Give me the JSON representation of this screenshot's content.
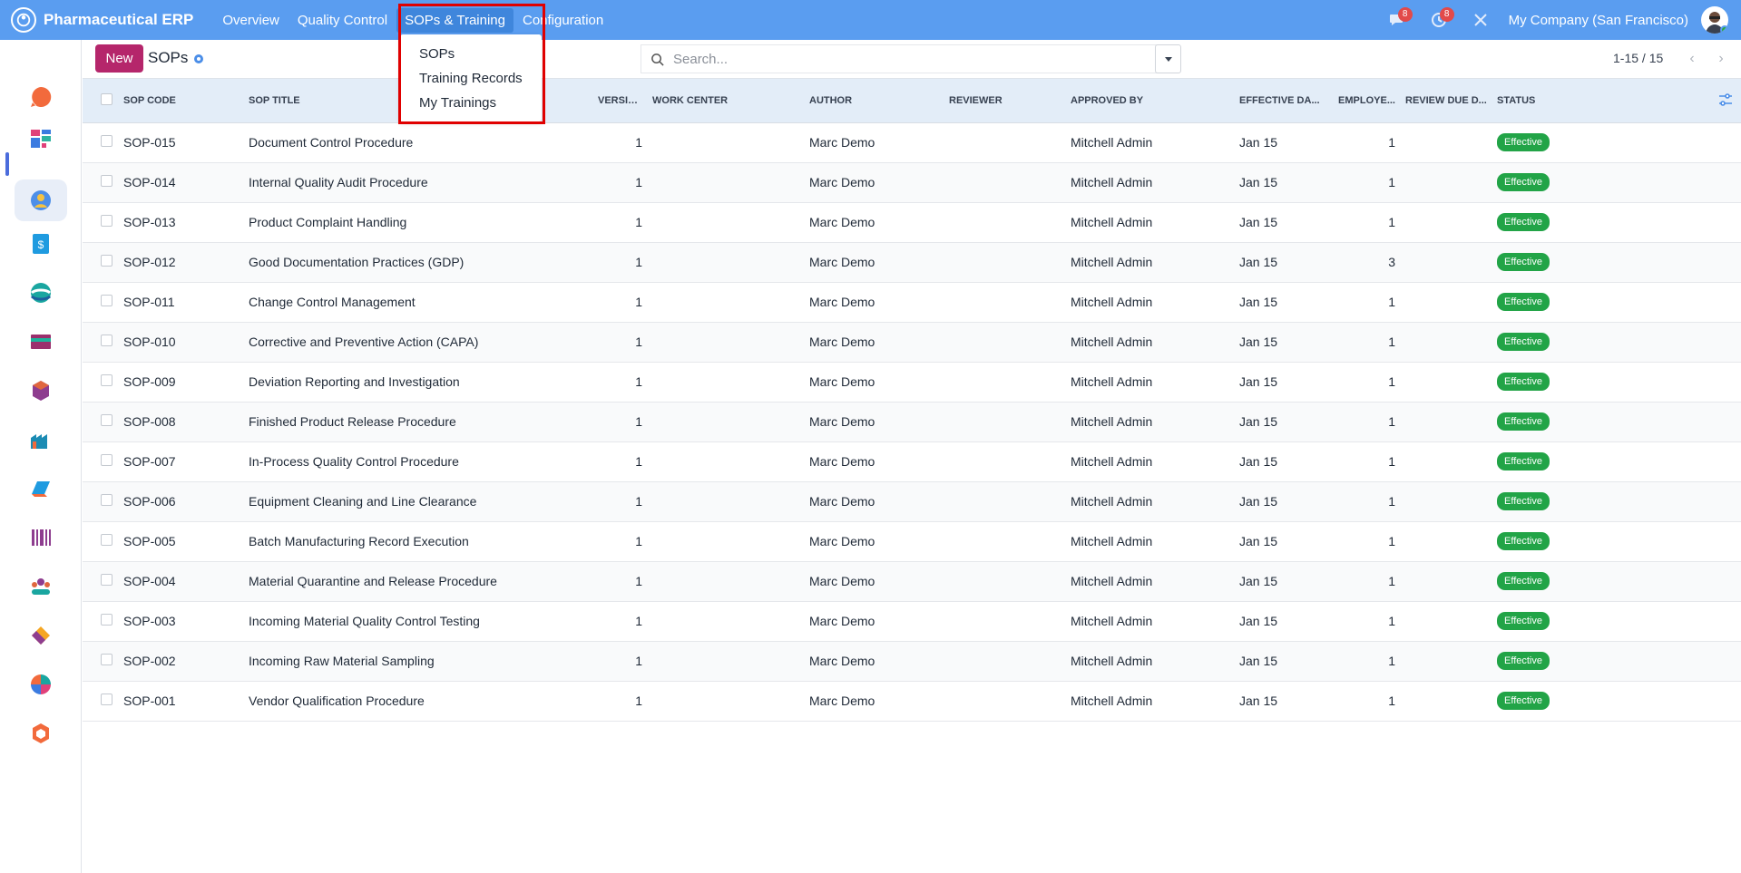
{
  "navbar": {
    "brand": "Pharmaceutical ERP",
    "menu": [
      "Overview",
      "Quality Control",
      "SOPs & Training",
      "Configuration"
    ],
    "active_menu": "SOPs & Training",
    "messages_badge": "8",
    "activities_badge": "8",
    "company": "My Company (San Francisco)"
  },
  "dropdown": {
    "items": [
      "SOPs",
      "Training Records",
      "My Trainings"
    ]
  },
  "control": {
    "new_label": "New",
    "title": "SOPs",
    "search_placeholder": "Search...",
    "pager": "1-15 / 15"
  },
  "sidebar": {
    "apps": [
      "discuss",
      "dashboards",
      "pharmaceutical-erp",
      "invoicing",
      "crm",
      "accounting",
      "inventory",
      "manufacturing",
      "sales",
      "barcode",
      "employees",
      "project",
      "reporting",
      "apps"
    ],
    "active_app": "pharmaceutical-erp"
  },
  "table": {
    "columns": [
      "SOP Code",
      "SOP Title",
      "Version",
      "Work Center",
      "Author",
      "Reviewer",
      "Approved By",
      "Effective Da...",
      "Employe...",
      "Review Due D...",
      "Status"
    ],
    "rows": [
      {
        "code": "SOP-015",
        "title": "Document Control Procedure",
        "version": "1",
        "work_center": "",
        "author": "Marc Demo",
        "reviewer": "",
        "approved_by": "Mitchell Admin",
        "effective": "Jan 15",
        "employees": "1",
        "review_due": "",
        "status": "Effective"
      },
      {
        "code": "SOP-014",
        "title": "Internal Quality Audit Procedure",
        "version": "1",
        "work_center": "",
        "author": "Marc Demo",
        "reviewer": "",
        "approved_by": "Mitchell Admin",
        "effective": "Jan 15",
        "employees": "1",
        "review_due": "",
        "status": "Effective"
      },
      {
        "code": "SOP-013",
        "title": "Product Complaint Handling",
        "version": "1",
        "work_center": "",
        "author": "Marc Demo",
        "reviewer": "",
        "approved_by": "Mitchell Admin",
        "effective": "Jan 15",
        "employees": "1",
        "review_due": "",
        "status": "Effective"
      },
      {
        "code": "SOP-012",
        "title": "Good Documentation Practices (GDP)",
        "version": "1",
        "work_center": "",
        "author": "Marc Demo",
        "reviewer": "",
        "approved_by": "Mitchell Admin",
        "effective": "Jan 15",
        "employees": "3",
        "review_due": "",
        "status": "Effective"
      },
      {
        "code": "SOP-011",
        "title": "Change Control Management",
        "version": "1",
        "work_center": "",
        "author": "Marc Demo",
        "reviewer": "",
        "approved_by": "Mitchell Admin",
        "effective": "Jan 15",
        "employees": "1",
        "review_due": "",
        "status": "Effective"
      },
      {
        "code": "SOP-010",
        "title": "Corrective and Preventive Action (CAPA)",
        "version": "1",
        "work_center": "",
        "author": "Marc Demo",
        "reviewer": "",
        "approved_by": "Mitchell Admin",
        "effective": "Jan 15",
        "employees": "1",
        "review_due": "",
        "status": "Effective"
      },
      {
        "code": "SOP-009",
        "title": "Deviation Reporting and Investigation",
        "version": "1",
        "work_center": "",
        "author": "Marc Demo",
        "reviewer": "",
        "approved_by": "Mitchell Admin",
        "effective": "Jan 15",
        "employees": "1",
        "review_due": "",
        "status": "Effective"
      },
      {
        "code": "SOP-008",
        "title": "Finished Product Release Procedure",
        "version": "1",
        "work_center": "",
        "author": "Marc Demo",
        "reviewer": "",
        "approved_by": "Mitchell Admin",
        "effective": "Jan 15",
        "employees": "1",
        "review_due": "",
        "status": "Effective"
      },
      {
        "code": "SOP-007",
        "title": "In-Process Quality Control Procedure",
        "version": "1",
        "work_center": "",
        "author": "Marc Demo",
        "reviewer": "",
        "approved_by": "Mitchell Admin",
        "effective": "Jan 15",
        "employees": "1",
        "review_due": "",
        "status": "Effective"
      },
      {
        "code": "SOP-006",
        "title": "Equipment Cleaning and Line Clearance",
        "version": "1",
        "work_center": "",
        "author": "Marc Demo",
        "reviewer": "",
        "approved_by": "Mitchell Admin",
        "effective": "Jan 15",
        "employees": "1",
        "review_due": "",
        "status": "Effective"
      },
      {
        "code": "SOP-005",
        "title": "Batch Manufacturing Record Execution",
        "version": "1",
        "work_center": "",
        "author": "Marc Demo",
        "reviewer": "",
        "approved_by": "Mitchell Admin",
        "effective": "Jan 15",
        "employees": "1",
        "review_due": "",
        "status": "Effective"
      },
      {
        "code": "SOP-004",
        "title": "Material Quarantine and Release Procedure",
        "version": "1",
        "work_center": "",
        "author": "Marc Demo",
        "reviewer": "",
        "approved_by": "Mitchell Admin",
        "effective": "Jan 15",
        "employees": "1",
        "review_due": "",
        "status": "Effective"
      },
      {
        "code": "SOP-003",
        "title": "Incoming Material Quality Control Testing",
        "version": "1",
        "work_center": "",
        "author": "Marc Demo",
        "reviewer": "",
        "approved_by": "Mitchell Admin",
        "effective": "Jan 15",
        "employees": "1",
        "review_due": "",
        "status": "Effective"
      },
      {
        "code": "SOP-002",
        "title": "Incoming Raw Material Sampling",
        "version": "1",
        "work_center": "",
        "author": "Marc Demo",
        "reviewer": "",
        "approved_by": "Mitchell Admin",
        "effective": "Jan 15",
        "employees": "1",
        "review_due": "",
        "status": "Effective"
      },
      {
        "code": "SOP-001",
        "title": "Vendor Qualification Procedure",
        "version": "1",
        "work_center": "",
        "author": "Marc Demo",
        "reviewer": "",
        "approved_by": "Mitchell Admin",
        "effective": "Jan 15",
        "employees": "1",
        "review_due": "",
        "status": "Effective"
      }
    ]
  },
  "colors": {
    "navbar": "#5a9df0",
    "new_button": "#b5266b",
    "status_effective": "#22a447",
    "highlight": "#e00000"
  }
}
